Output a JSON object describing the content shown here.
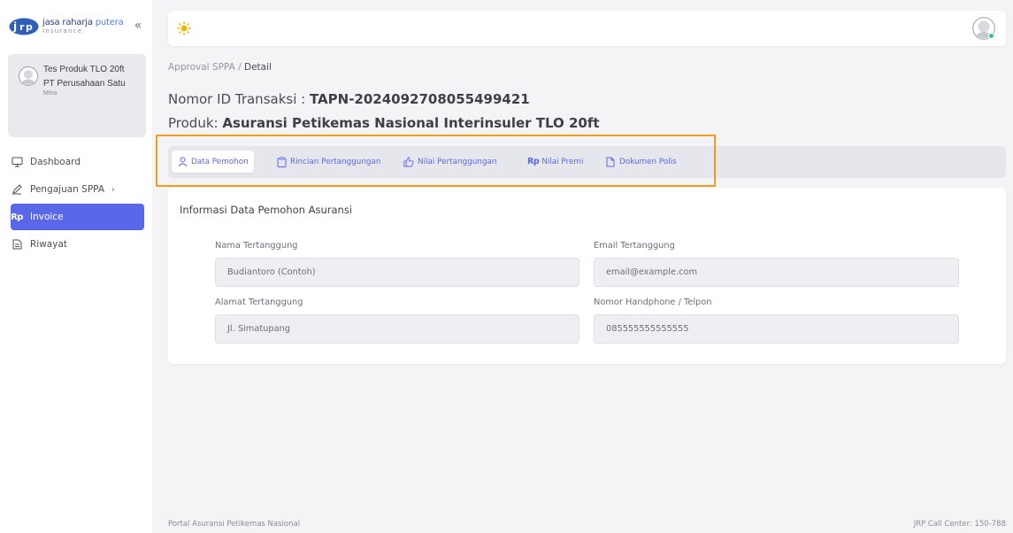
{
  "brand": {
    "name_main": "jasa raharja ",
    "name_accent": "putera",
    "sub": "Insurance"
  },
  "sidebar": {
    "collapse_label": "«",
    "profile": {
      "name": "Tes Produk TLO 20ft",
      "company": "PT Perusahaan Satu",
      "role": "Mitra"
    },
    "items": [
      {
        "label": "Dashboard",
        "icon": "monitor-icon"
      },
      {
        "label": "Pengajuan SPPA",
        "icon": "pencil-icon",
        "chevron": "›"
      },
      {
        "label": "Invoice",
        "icon": "rupiah-icon",
        "badge": "Rp",
        "active": true
      },
      {
        "label": "Riwayat",
        "icon": "document-icon"
      }
    ]
  },
  "breadcrumb": {
    "parent": "Approval SPPA",
    "separator": " / ",
    "current": "Detail"
  },
  "header": {
    "id_label": "Nomor ID Transaksi : ",
    "id_value": "TAPN-2024092708055499421",
    "product_label": "Produk: ",
    "product_value": "Asuransi Petikemas Nasional Interinsuler TLO 20ft"
  },
  "tabs": [
    {
      "label": "Data Pemohon",
      "icon": "user-icon",
      "active": true
    },
    {
      "label": "Rincian Pertanggungan",
      "icon": "clipboard-icon"
    },
    {
      "label": "Nilai Pertanggungan",
      "icon": "thumbs-up-icon"
    },
    {
      "label": "Nilai Premi",
      "icon": "rupiah-icon",
      "badge": "Rp"
    },
    {
      "label": "Dokumen Polis",
      "icon": "file-icon"
    }
  ],
  "card": {
    "title": "Informasi Data Pemohon Asuransi",
    "fields": [
      {
        "label": "Nama Tertanggung",
        "value": "Budiantoro (Contoh)"
      },
      {
        "label": "Email Tertanggung",
        "value": "email@example.com"
      },
      {
        "label": "Alamat Tertanggung",
        "value": "Jl. Simatupang"
      },
      {
        "label": "Nomor Handphone / Telpon",
        "value": "085555555555555"
      }
    ]
  },
  "footer": {
    "left": "Portal Asuransi Petikemas Nasional",
    "right": "JRP Call Center: 150-788"
  },
  "colors": {
    "accent": "#5a67e8",
    "highlight": "#f29b1c",
    "sun": "#f5b400"
  }
}
